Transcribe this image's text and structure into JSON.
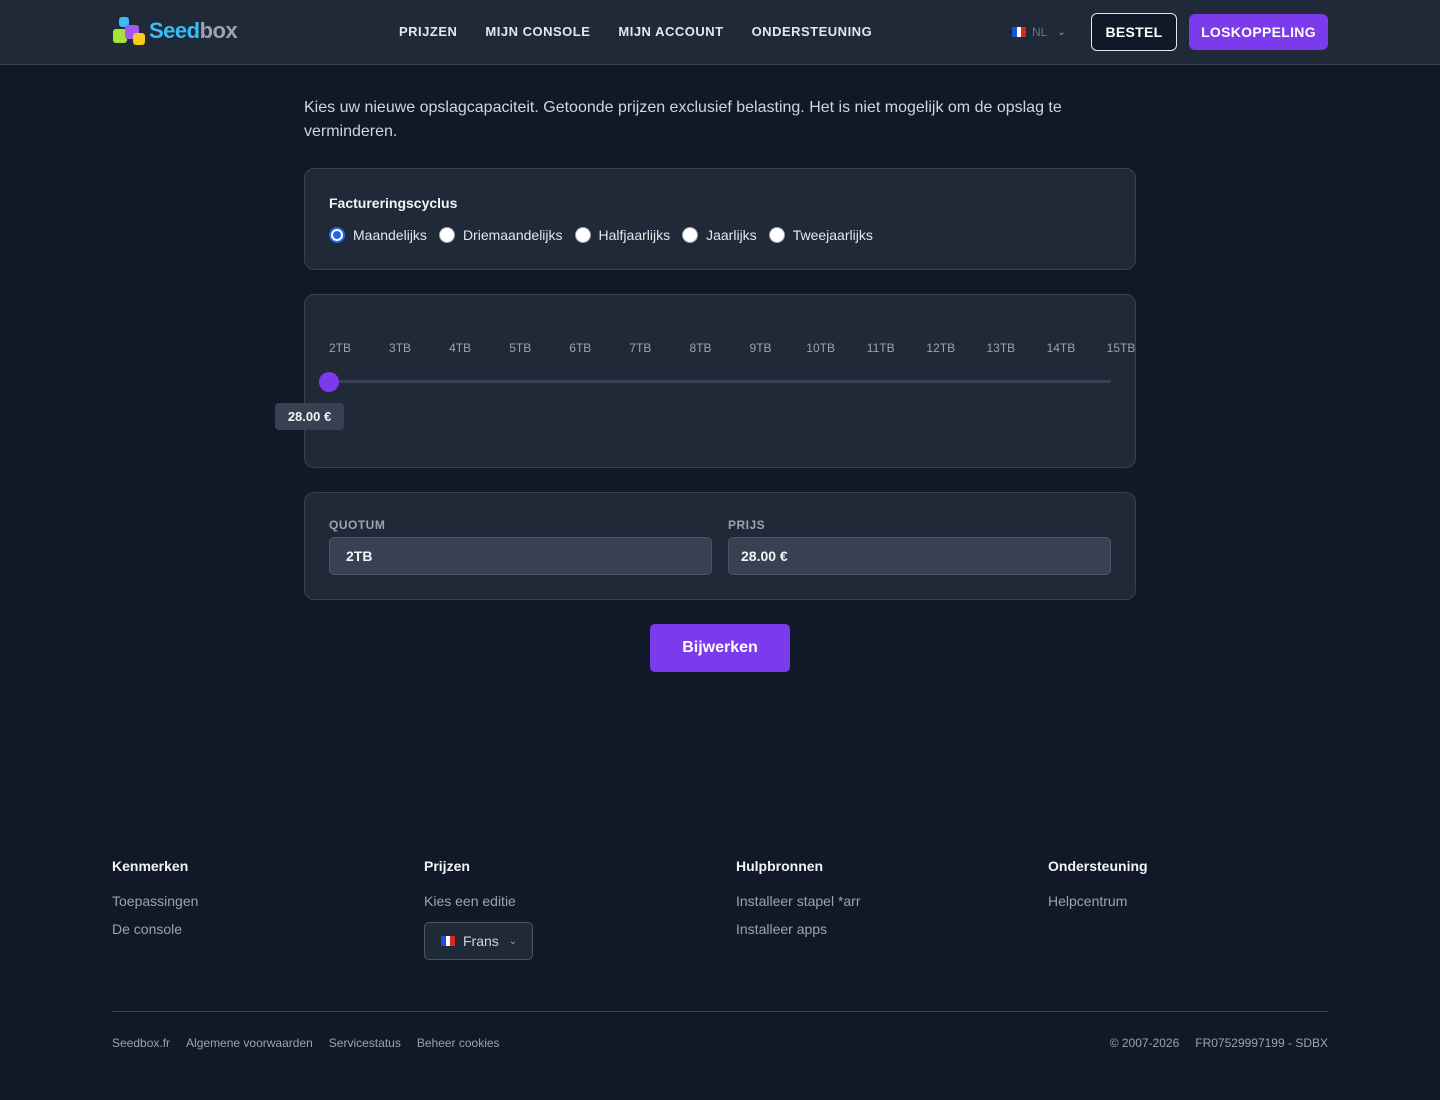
{
  "header": {
    "logo_alt": "Seedbox",
    "logo_seed": "Seed",
    "logo_box": "box",
    "nav": [
      "PRIJZEN",
      "MIJN CONSOLE",
      "MIJN ACCOUNT",
      "ONDERSTEUNING"
    ],
    "lang_code": "NL",
    "order_label": "BESTEL",
    "logout_label": "LOSKOPPELING"
  },
  "main": {
    "intro": "Kies uw nieuwe opslagcapaciteit. Getoonde prijzen exclusief belasting. Het is niet mogelijk om de opslag te verminderen.",
    "billing": {
      "title": "Factureringscyclus",
      "options": [
        "Maandelijks",
        "Driemaandelijks",
        "Halfjaarlijks",
        "Jaarlijks",
        "Tweejaarlijks"
      ],
      "selected": "Maandelijks"
    },
    "slider": {
      "ticks": [
        "2TB",
        "3TB",
        "4TB",
        "5TB",
        "6TB",
        "7TB",
        "8TB",
        "9TB",
        "10TB",
        "11TB",
        "12TB",
        "13TB",
        "14TB",
        "15TB"
      ],
      "value_index": 0,
      "tooltip": "28.00 €"
    },
    "quota": {
      "quota_label": "QUOTUM",
      "quota_value": "2TB",
      "price_label": "PRIJS",
      "price_value": "28.00 €"
    },
    "update_label": "Bijwerken"
  },
  "footer": {
    "columns": [
      {
        "title": "Kenmerken",
        "links": [
          "Toepassingen",
          "De console"
        ]
      },
      {
        "title": "Prijzen",
        "links": [
          "Kies een editie"
        ]
      },
      {
        "title": "Hulpbronnen",
        "links": [
          "Installeer stapel *arr",
          "Installeer apps"
        ]
      },
      {
        "title": "Ondersteuning",
        "links": [
          "Helpcentrum"
        ]
      }
    ],
    "language_select": "Frans",
    "bottom_links": [
      "Seedbox.fr",
      "Algemene voorwaarden",
      "Servicestatus",
      "Beheer cookies"
    ],
    "copyright": "© 2007-2026",
    "company_id": "FR07529997199 - SDBX"
  },
  "colors": {
    "accent": "#7c3aed",
    "background": "#111827",
    "card": "#1f2937"
  },
  "icons": [
    "flag-fr-icon",
    "chevron-down-icon"
  ]
}
